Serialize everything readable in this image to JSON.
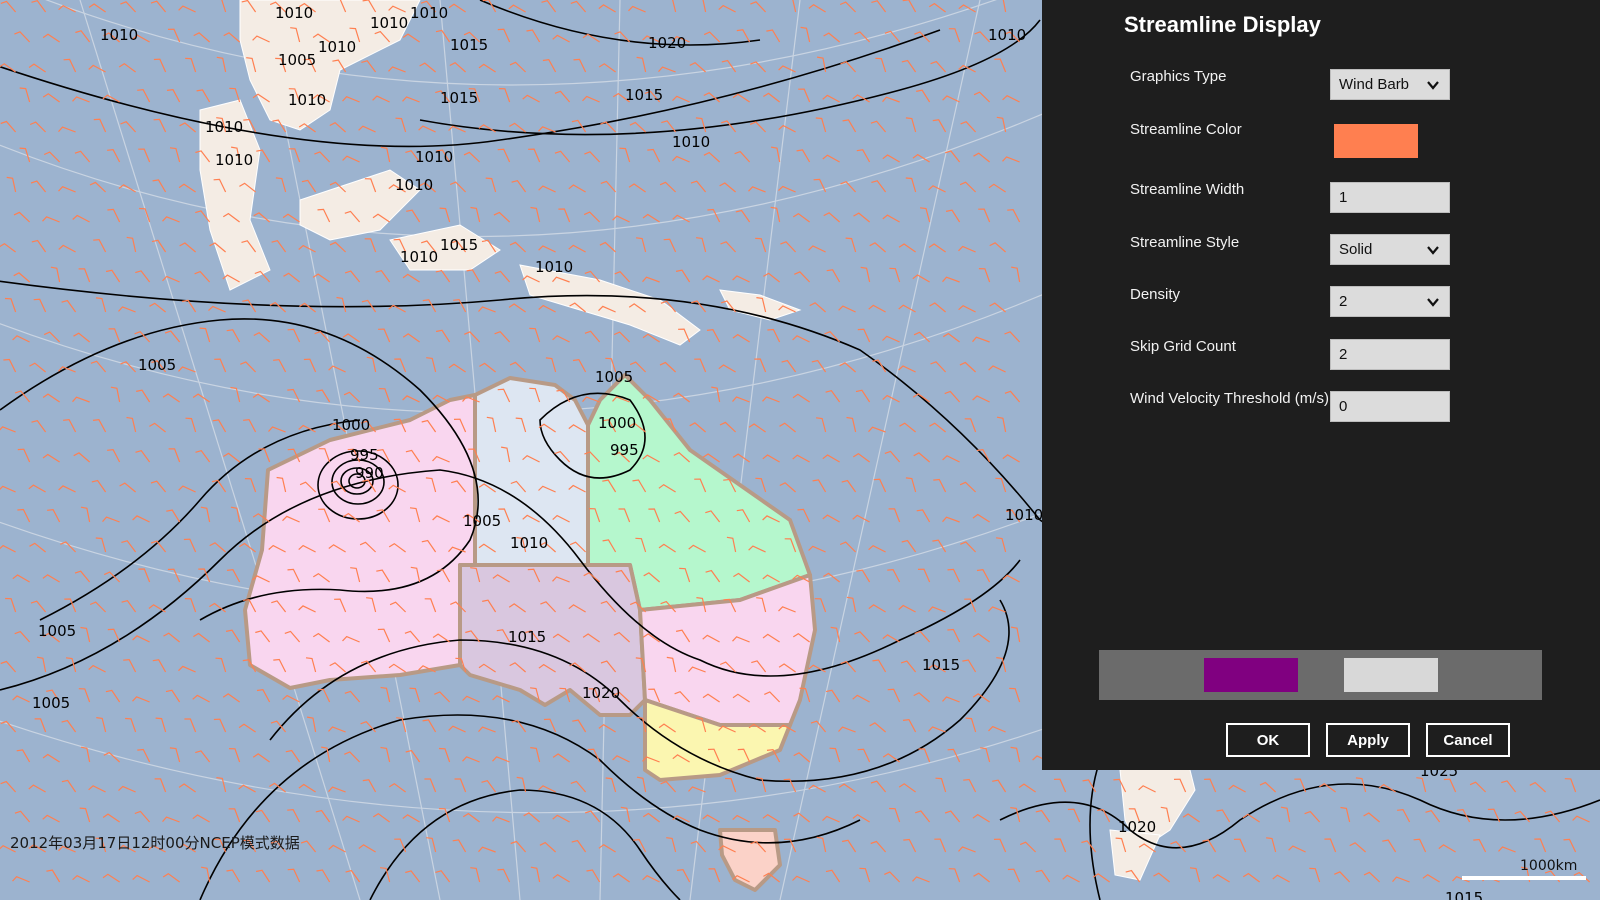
{
  "map": {
    "datestamp": "2012年03月17日12时00分NCEP模式数据",
    "scale_label": "1000km",
    "colors": {
      "ocean": "#9cb3cf",
      "land": "#f4ece4",
      "wind_barb": "#ff7f50",
      "region_west": "#f9d6ef",
      "region_north": "#dde6f2",
      "region_queensland": "#b5f7cd",
      "region_south": "#d9c7df",
      "region_nsw": "#f9d6ef",
      "region_victoria": "#fbf6b0",
      "region_tasmania": "#fbd2c8"
    },
    "isobar_labels": [
      "1010",
      "1010",
      "1010",
      "1010",
      "1015",
      "1020",
      "1015",
      "1015",
      "1010",
      "1010",
      "1005",
      "1010",
      "1010",
      "1010",
      "1010",
      "1010",
      "1015",
      "1010",
      "1010",
      "1005",
      "1000",
      "995",
      "990",
      "1005",
      "1000",
      "995",
      "1005",
      "1010",
      "1015",
      "1020",
      "1005",
      "1005",
      "1015",
      "1010",
      "1025",
      "1020",
      "1015",
      "1010"
    ]
  },
  "panel": {
    "title": "Streamline Display",
    "fields": {
      "graphics_type": {
        "label": "Graphics Type",
        "value": "Wind Barb"
      },
      "streamline_color": {
        "label": "Streamline Color",
        "value": "#ff7f50"
      },
      "streamline_width": {
        "label": "Streamline Width",
        "value": "1"
      },
      "streamline_style": {
        "label": "Streamline Style",
        "value": "Solid"
      },
      "density": {
        "label": "Density",
        "value": "2"
      },
      "skip_grid_count": {
        "label": "Skip Grid Count",
        "value": "2"
      },
      "wind_velocity_threshold": {
        "label": "Wind Velocity Threshold (m/s)",
        "value": "0"
      }
    },
    "swatches": {
      "primary": "#800080",
      "secondary": "#d8d8d8"
    },
    "buttons": {
      "ok": "OK",
      "apply": "Apply",
      "cancel": "Cancel"
    }
  }
}
